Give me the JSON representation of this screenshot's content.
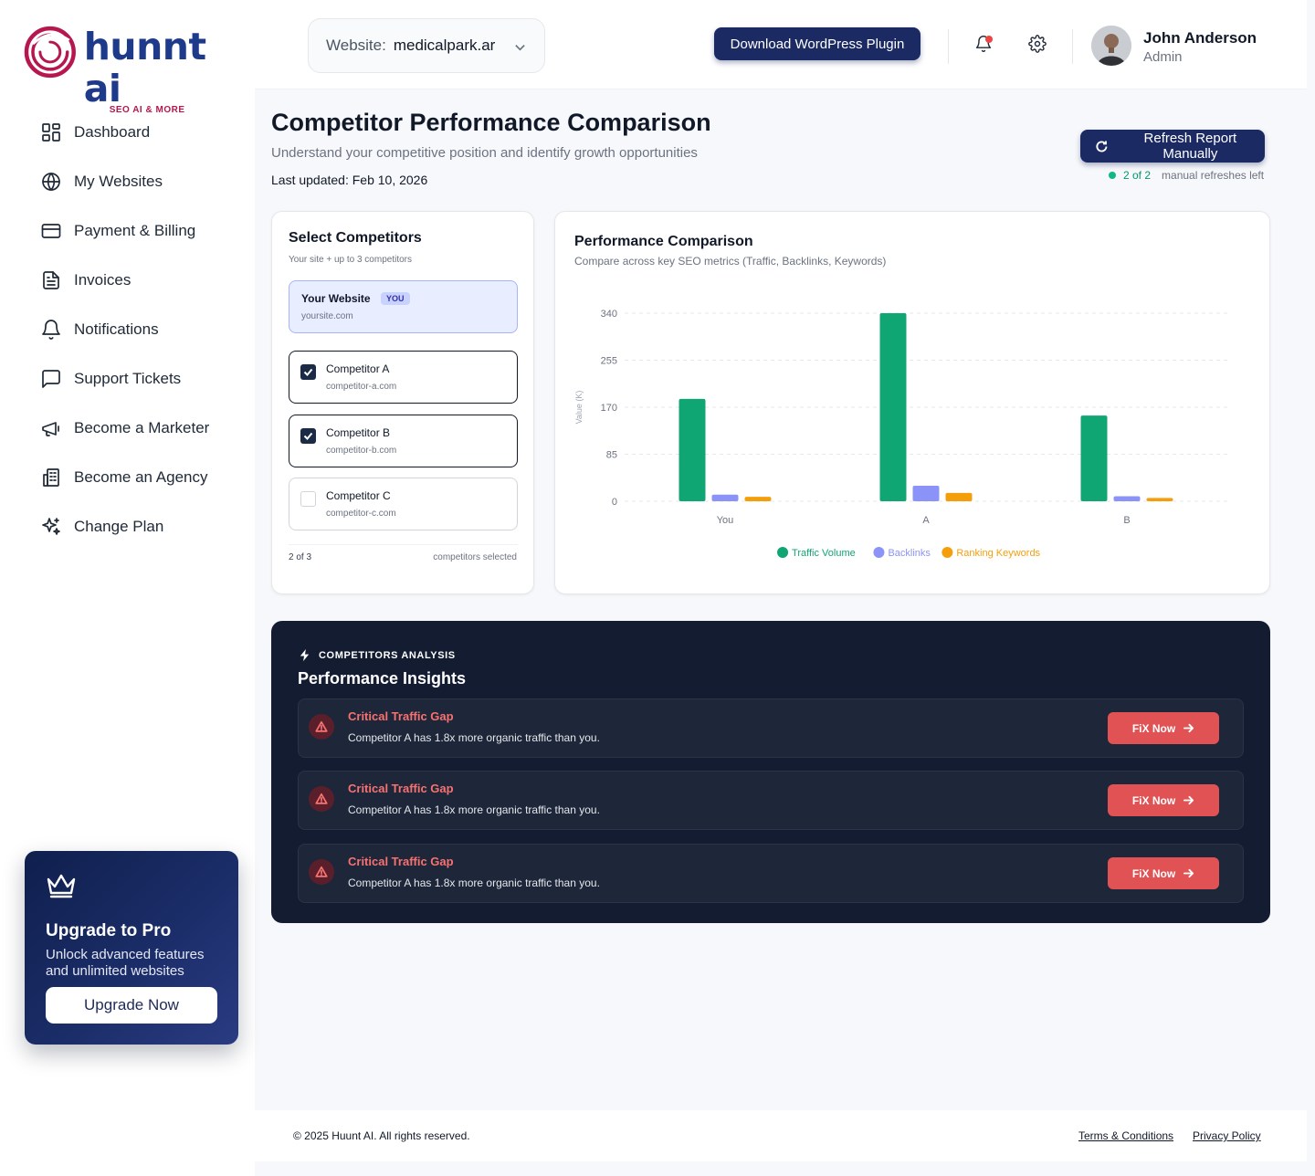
{
  "brand": {
    "name": "hunnt ai",
    "tagline": "SEO AI & MORE",
    "logo_color": "#b5174e",
    "primary_color": "#1b2a63"
  },
  "sidebar": {
    "items": [
      {
        "label": "Dashboard",
        "icon": "dashboard-icon"
      },
      {
        "label": "My Websites",
        "icon": "globe-icon"
      },
      {
        "label": "Payment & Billing",
        "icon": "credit-card-icon"
      },
      {
        "label": "Invoices",
        "icon": "invoice-icon"
      },
      {
        "label": "Notifications",
        "icon": "bell-icon"
      },
      {
        "label": "Support Tickets",
        "icon": "chat-icon"
      },
      {
        "label": "Become a Marketer",
        "icon": "megaphone-icon"
      },
      {
        "label": "Become an Agency",
        "icon": "building-icon"
      },
      {
        "label": "Change Plan",
        "icon": "sparkles-icon"
      }
    ],
    "upgrade": {
      "title": "Upgrade to Pro",
      "text": "Unlock advanced features and unlimited websites",
      "button": "Upgrade Now"
    }
  },
  "topbar": {
    "website_label": "Website:",
    "website_value": "medicalpark.ar",
    "download_button": "Download WordPress Plugin",
    "user_name": "John Anderson",
    "user_role": "Admin",
    "notification_dot_color": "#ef4444"
  },
  "page": {
    "title": "Competitor Performance Comparison",
    "subtitle": "Understand your competitive position and identify growth opportunities",
    "last_updated": "Last updated: Feb 10, 2026",
    "refresh_button": "Refresh Report Manually",
    "refresh_count": "2 of 2",
    "refresh_label": "manual refreshes left"
  },
  "selector": {
    "title": "Select Competitors",
    "subtitle": "Your site + up to 3 competitors",
    "your_site": {
      "name": "Your Website",
      "badge": "YOU",
      "url": "yoursite.com"
    },
    "competitors": [
      {
        "name": "Competitor A",
        "url": "competitor-a.com",
        "checked": true
      },
      {
        "name": "Competitor B",
        "url": "competitor-b.com",
        "checked": true
      },
      {
        "name": "Competitor C",
        "url": "competitor-c.com",
        "checked": false
      }
    ],
    "count": "2 of 3",
    "count_label": "competitors selected"
  },
  "chart_card": {
    "title": "Performance Comparison",
    "subtitle": "Compare across key SEO metrics (Traffic, Backlinks, Keywords)"
  },
  "chart_data": {
    "type": "bar",
    "categories": [
      "You",
      "A",
      "B"
    ],
    "series": [
      {
        "name": "Traffic Volume",
        "color": "#10a673",
        "values": [
          185,
          340,
          155
        ]
      },
      {
        "name": "Backlinks",
        "color": "#8b93f8",
        "values": [
          12,
          28,
          9
        ]
      },
      {
        "name": "Ranking Keywords",
        "color": "#f59e0b",
        "values": [
          8,
          15,
          6
        ]
      }
    ],
    "ylabel": "Value (K)",
    "yticks": [
      0,
      85,
      170,
      255,
      340
    ],
    "ylim": [
      0,
      340
    ],
    "grid": true,
    "legend": "bottom-center"
  },
  "insights": {
    "kicker": "COMPETITORS ANALYSIS",
    "title": "Performance Insights",
    "items": [
      {
        "heading": "Critical Traffic Gap",
        "text": "Competitor A has 1.8x more organic traffic than you.",
        "button": "FiX Now"
      },
      {
        "heading": "Critical Traffic Gap",
        "text": "Competitor A has 1.8x more organic traffic than you.",
        "button": "FiX Now"
      },
      {
        "heading": "Critical Traffic Gap",
        "text": "Competitor A has 1.8x more organic traffic than you.",
        "button": "FiX Now"
      }
    ]
  },
  "footer": {
    "copyright": "© 2025 Huunt AI. All rights reserved.",
    "terms": "Terms & Conditions",
    "privacy": "Privacy Policy"
  }
}
